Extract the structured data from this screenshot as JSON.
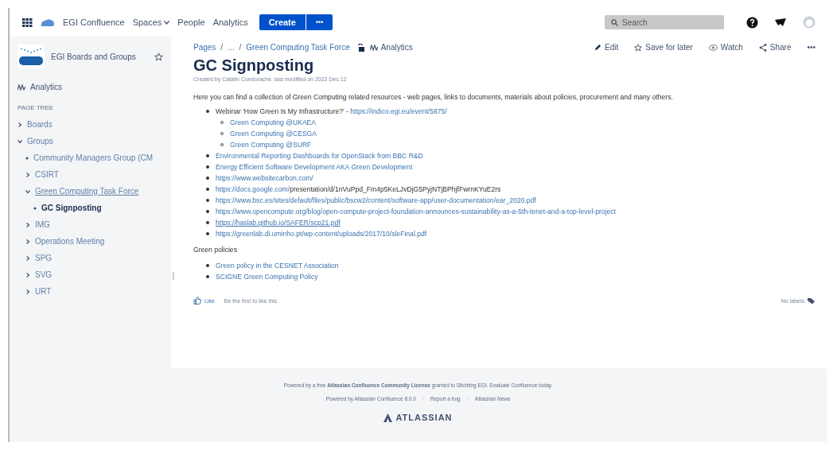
{
  "top_nav": {
    "product": "EGI Confluence",
    "items": [
      {
        "label": "Spaces",
        "dropdown": true
      },
      {
        "label": "People",
        "dropdown": false
      },
      {
        "label": "Analytics",
        "dropdown": false
      }
    ],
    "create_button": "Create",
    "more_button": "•••",
    "search": {
      "placeholder": "Search"
    }
  },
  "sidebar": {
    "space_name": "EGI Boards and Groups",
    "analytics": "Analytics",
    "page_tree_heading": "PAGE TREE",
    "page_tree": [
      {
        "label": "Boards",
        "kind": "branch",
        "expanded": false,
        "selected": false
      },
      {
        "label": "Groups",
        "kind": "branch",
        "expanded": true,
        "selected": false,
        "children": [
          {
            "label": "Community Managers Group (CM",
            "kind": "leaf",
            "selected": false
          },
          {
            "label": "CSIRT",
            "kind": "branch",
            "expanded": false,
            "selected": false
          },
          {
            "label": "Green Computing Task Force",
            "kind": "branch",
            "expanded": true,
            "selected": false,
            "children": [
              {
                "label": "GC Signposting",
                "kind": "leaf",
                "selected": true
              }
            ]
          },
          {
            "label": "IMG",
            "kind": "branch",
            "expanded": false,
            "selected": false
          },
          {
            "label": "Operations Meeting",
            "kind": "branch",
            "expanded": false,
            "selected": false
          },
          {
            "label": "SPG",
            "kind": "branch",
            "expanded": false,
            "selected": false
          },
          {
            "label": "SVG",
            "kind": "branch",
            "expanded": false,
            "selected": false
          },
          {
            "label": "URT",
            "kind": "branch",
            "expanded": false,
            "selected": false
          }
        ]
      }
    ]
  },
  "breadcrumbs": [
    "Pages",
    "...",
    "Green Computing Task Force"
  ],
  "breadcrumb_separator": "/",
  "breadcrumb_analytics": "Analytics",
  "page_actions": [
    "Edit",
    "Save for later",
    "Watch",
    "Share",
    "•••"
  ],
  "page": {
    "title": "GC Signposting",
    "byline": "Created by Catalin Condurache, last modified on 2022 Dec 12",
    "intro": "Here you can find a collection of Green Computing related resources - web pages, links to documents, materials about policies, procurement and many others.",
    "resources": [
      {
        "segments": [
          {
            "text": "Webinar 'How Green Is My Infrastructure?' - ",
            "link": false
          },
          {
            "text": "https://indico.egi.eu/event/5875/",
            "link": true
          }
        ],
        "children": [
          {
            "segments": [
              {
                "text": "Green Computing @UKAEA",
                "link": true
              }
            ]
          },
          {
            "segments": [
              {
                "text": "Green Computing @CESGA",
                "link": true
              }
            ]
          },
          {
            "segments": [
              {
                "text": "Green Computing @SURF",
                "link": true
              }
            ]
          }
        ]
      },
      {
        "segments": [
          {
            "text": "Environmental Reporting Dashboards for OpenStack from BBC R&D",
            "link": true
          }
        ]
      },
      {
        "segments": [
          {
            "text": "Energy Efficient Software Development AKA Green Development",
            "link": true
          }
        ]
      },
      {
        "segments": [
          {
            "text": "https://www.websitecarbon.com/",
            "link": true
          }
        ]
      },
      {
        "segments": [
          {
            "text": "https://docs.google.com/",
            "link": true
          },
          {
            "text": "presentation/d/1nVuPpd_Fm4p5KeLJvDjG5PyjNTjBPhjfFwrnKYuE2rs",
            "link": false
          }
        ]
      },
      {
        "segments": [
          {
            "text": "https://www.bsc.es/sites/default/files/public/bscw2/content/software-app/user-documentation/ear_2020.pdf",
            "link": true
          }
        ]
      },
      {
        "segments": [
          {
            "text": "https://www.opencompute.org/blog/open-compute-project-foundation-announces-sustainability-as-a-5th-tenet-and-a-top-level-project",
            "link": true
          }
        ]
      },
      {
        "segments": [
          {
            "text": "https://haslab.github.io/SAFER/scp21.pdf",
            "link": true,
            "underlined": true
          }
        ]
      },
      {
        "segments": [
          {
            "text": "https://greenlab.di.uminho.pt/wp-content/uploads/2017/10/sleFinal.pdf",
            "link": true
          }
        ]
      }
    ],
    "section_heading": "Green policies",
    "policies": [
      {
        "segments": [
          {
            "text": "Green policy in the CESNET Association",
            "link": true
          }
        ]
      },
      {
        "segments": [
          {
            "text": "SCIGNE Green Computing Policy",
            "link": true
          }
        ]
      }
    ],
    "like_button": "Like",
    "like_note": "Be the first to like this",
    "labels": "No labels"
  },
  "footer": {
    "license": "Powered by a free **Atlassian Confluence Community License** granted to Stichting EGI. Evaluate Confluence today.",
    "links": [
      "Powered by Atlassian Confluence 8.0.0",
      "Report a bug",
      "Atlassian News"
    ],
    "separator": "·",
    "brand": "ATLASSIAN"
  }
}
